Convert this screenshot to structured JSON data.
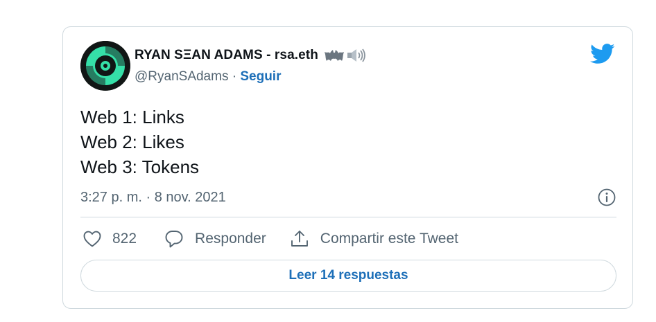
{
  "author": {
    "display_name": "RYAN SΞAN ADAMS - rsa.eth",
    "handle": "@RyanSAdams",
    "separator": "·",
    "follow_label": "Seguir",
    "emoji_icons": [
      "bat-icon",
      "speaker-icon"
    ]
  },
  "tweet": {
    "lines": [
      "Web 1: Links",
      "Web 2: Likes",
      "Web 3: Tokens"
    ],
    "timestamp": "3:27 p. m. · 8 nov. 2021"
  },
  "actions": {
    "like_count": "822",
    "reply_label": "Responder",
    "share_label": "Compartir este Tweet"
  },
  "read_replies_label": "Leer 14 respuestas",
  "colors": {
    "twitter_blue": "#1d9bf0",
    "link_blue": "#1d6fb8",
    "avatar_green": "#35e0a8",
    "text_primary": "#0f1419",
    "text_secondary": "#536471",
    "border": "#cfd9de"
  }
}
